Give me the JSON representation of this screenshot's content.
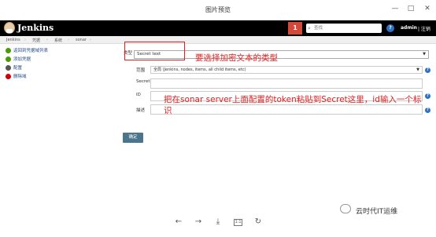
{
  "viewer": {
    "title": "图片预览"
  },
  "header": {
    "brand": "Jenkins",
    "badge": "1",
    "search_placeholder": "查找",
    "help": "?",
    "user": "admin",
    "logout": "| 注销"
  },
  "breadcrumb": [
    "Jenkins",
    "凭据",
    "系统",
    "sonar"
  ],
  "sidebar": {
    "items": [
      {
        "label": "返回到凭据域列表",
        "icon": "up-arrow-icon",
        "color": "#4e9a06"
      },
      {
        "label": "添加凭据",
        "icon": "add-icon",
        "color": "#4e9a06"
      },
      {
        "label": "配置",
        "icon": "gear-icon",
        "color": "#555753"
      },
      {
        "label": "删除域",
        "icon": "delete-icon",
        "color": "#cc0000"
      }
    ]
  },
  "form": {
    "kind_label": "类型",
    "kind_value": "Secret text",
    "scope_label": "范围",
    "scope_value": "全局 (Jenkins, nodes, items, all child items, etc)",
    "secret_label": "Secret",
    "id_label": "ID",
    "description_label": "描述",
    "ok_label": "确定"
  },
  "annotations": {
    "select_type": "要选择加密文本的类型",
    "token_line1": "把在sonar server上面配置的token粘贴到Secret这里，id输入一个标",
    "token_line2": "识"
  },
  "watermark": "云时代IT运维",
  "colors": {
    "annotation": "#e02020",
    "header": "#000000",
    "badge": "#d24939",
    "button": "#4b758b"
  }
}
